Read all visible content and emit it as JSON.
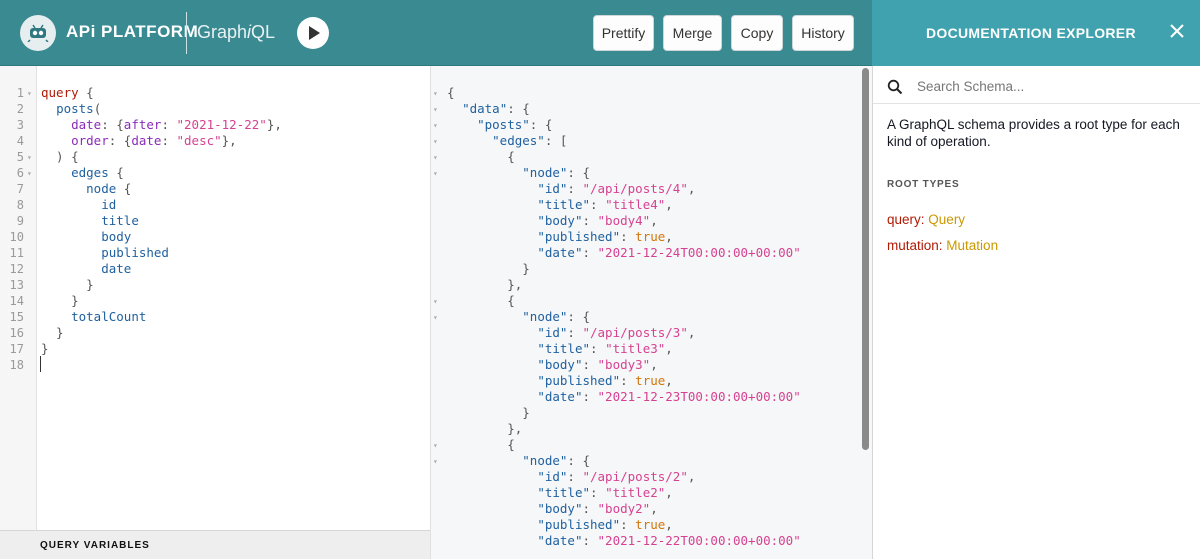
{
  "header": {
    "brand": "APi PLATFORM",
    "product_prefix": "Graph",
    "product_italic": "i",
    "product_suffix": "QL",
    "buttons": {
      "prettify": "Prettify",
      "merge": "Merge",
      "copy": "Copy",
      "history": "History"
    }
  },
  "docs": {
    "title": "DOCUMENTATION EXPLORER",
    "search_placeholder": "Search Schema...",
    "description": "A GraphQL schema provides a root type for each kind of operation.",
    "root_types_label": "ROOT TYPES",
    "root_types": [
      {
        "field": "query",
        "type": "Query"
      },
      {
        "field": "mutation",
        "type": "Mutation"
      }
    ]
  },
  "query_variables_label": "QUERY VARIABLES",
  "query_editor": {
    "lines": [
      [
        [
          "kw",
          "query"
        ],
        [
          "pun",
          " {"
        ]
      ],
      [
        [
          "pun",
          "  "
        ],
        [
          "fld",
          "posts"
        ],
        [
          "pun",
          "("
        ]
      ],
      [
        [
          "pun",
          "    "
        ],
        [
          "arg",
          "date"
        ],
        [
          "pun",
          ": {"
        ],
        [
          "arg",
          "after"
        ],
        [
          "pun",
          ": "
        ],
        [
          "str",
          "\"2021-12-22\""
        ],
        [
          "pun",
          "},"
        ]
      ],
      [
        [
          "pun",
          "    "
        ],
        [
          "arg",
          "order"
        ],
        [
          "pun",
          ": {"
        ],
        [
          "arg",
          "date"
        ],
        [
          "pun",
          ": "
        ],
        [
          "str",
          "\"desc\""
        ],
        [
          "pun",
          "},"
        ]
      ],
      [
        [
          "pun",
          "  ) {"
        ]
      ],
      [
        [
          "pun",
          "    "
        ],
        [
          "fld",
          "edges"
        ],
        [
          "pun",
          " {"
        ]
      ],
      [
        [
          "pun",
          "      "
        ],
        [
          "fld",
          "node"
        ],
        [
          "pun",
          " {"
        ]
      ],
      [
        [
          "pun",
          "        "
        ],
        [
          "fld",
          "id"
        ]
      ],
      [
        [
          "pun",
          "        "
        ],
        [
          "fld",
          "title"
        ]
      ],
      [
        [
          "pun",
          "        "
        ],
        [
          "fld",
          "body"
        ]
      ],
      [
        [
          "pun",
          "        "
        ],
        [
          "fld",
          "published"
        ]
      ],
      [
        [
          "pun",
          "        "
        ],
        [
          "fld",
          "date"
        ]
      ],
      [
        [
          "pun",
          "      }"
        ]
      ],
      [
        [
          "pun",
          "    }"
        ]
      ],
      [
        [
          "pun",
          "    "
        ],
        [
          "fld",
          "totalCount"
        ]
      ],
      [
        [
          "pun",
          "  }"
        ]
      ],
      [
        [
          "pun",
          "}"
        ]
      ],
      [
        [
          "pun",
          ""
        ]
      ]
    ],
    "line_numbers": [
      "1",
      "2",
      "3",
      "4",
      "5",
      "6",
      "7",
      "8",
      "9",
      "10",
      "11",
      "12",
      "13",
      "14",
      "15",
      "16",
      "17",
      "18"
    ],
    "fold_lines": [
      1,
      5,
      6
    ]
  },
  "result_viewer": {
    "lines": [
      [
        [
          "pun",
          "{"
        ]
      ],
      [
        [
          "pun",
          "  "
        ],
        [
          "rkey",
          "\"data\""
        ],
        [
          "pun",
          ": {"
        ]
      ],
      [
        [
          "pun",
          "    "
        ],
        [
          "rkey",
          "\"posts\""
        ],
        [
          "pun",
          ": {"
        ]
      ],
      [
        [
          "pun",
          "      "
        ],
        [
          "rkey",
          "\"edges\""
        ],
        [
          "pun",
          ": ["
        ]
      ],
      [
        [
          "pun",
          "        {"
        ]
      ],
      [
        [
          "pun",
          "          "
        ],
        [
          "rkey",
          "\"node\""
        ],
        [
          "pun",
          ": {"
        ]
      ],
      [
        [
          "pun",
          "            "
        ],
        [
          "rkey",
          "\"id\""
        ],
        [
          "pun",
          ": "
        ],
        [
          "str",
          "\"/api/posts/4\""
        ],
        [
          "pun",
          ","
        ]
      ],
      [
        [
          "pun",
          "            "
        ],
        [
          "rkey",
          "\"title\""
        ],
        [
          "pun",
          ": "
        ],
        [
          "str",
          "\"title4\""
        ],
        [
          "pun",
          ","
        ]
      ],
      [
        [
          "pun",
          "            "
        ],
        [
          "rkey",
          "\"body\""
        ],
        [
          "pun",
          ": "
        ],
        [
          "str",
          "\"body4\""
        ],
        [
          "pun",
          ","
        ]
      ],
      [
        [
          "pun",
          "            "
        ],
        [
          "rkey",
          "\"published\""
        ],
        [
          "pun",
          ": "
        ],
        [
          "bool",
          "true"
        ],
        [
          "pun",
          ","
        ]
      ],
      [
        [
          "pun",
          "            "
        ],
        [
          "rkey",
          "\"date\""
        ],
        [
          "pun",
          ": "
        ],
        [
          "str",
          "\"2021-12-24T00:00:00+00:00\""
        ]
      ],
      [
        [
          "pun",
          "          }"
        ]
      ],
      [
        [
          "pun",
          "        },"
        ]
      ],
      [
        [
          "pun",
          "        {"
        ]
      ],
      [
        [
          "pun",
          "          "
        ],
        [
          "rkey",
          "\"node\""
        ],
        [
          "pun",
          ": {"
        ]
      ],
      [
        [
          "pun",
          "            "
        ],
        [
          "rkey",
          "\"id\""
        ],
        [
          "pun",
          ": "
        ],
        [
          "str",
          "\"/api/posts/3\""
        ],
        [
          "pun",
          ","
        ]
      ],
      [
        [
          "pun",
          "            "
        ],
        [
          "rkey",
          "\"title\""
        ],
        [
          "pun",
          ": "
        ],
        [
          "str",
          "\"title3\""
        ],
        [
          "pun",
          ","
        ]
      ],
      [
        [
          "pun",
          "            "
        ],
        [
          "rkey",
          "\"body\""
        ],
        [
          "pun",
          ": "
        ],
        [
          "str",
          "\"body3\""
        ],
        [
          "pun",
          ","
        ]
      ],
      [
        [
          "pun",
          "            "
        ],
        [
          "rkey",
          "\"published\""
        ],
        [
          "pun",
          ": "
        ],
        [
          "bool",
          "true"
        ],
        [
          "pun",
          ","
        ]
      ],
      [
        [
          "pun",
          "            "
        ],
        [
          "rkey",
          "\"date\""
        ],
        [
          "pun",
          ": "
        ],
        [
          "str",
          "\"2021-12-23T00:00:00+00:00\""
        ]
      ],
      [
        [
          "pun",
          "          }"
        ]
      ],
      [
        [
          "pun",
          "        },"
        ]
      ],
      [
        [
          "pun",
          "        {"
        ]
      ],
      [
        [
          "pun",
          "          "
        ],
        [
          "rkey",
          "\"node\""
        ],
        [
          "pun",
          ": {"
        ]
      ],
      [
        [
          "pun",
          "            "
        ],
        [
          "rkey",
          "\"id\""
        ],
        [
          "pun",
          ": "
        ],
        [
          "str",
          "\"/api/posts/2\""
        ],
        [
          "pun",
          ","
        ]
      ],
      [
        [
          "pun",
          "            "
        ],
        [
          "rkey",
          "\"title\""
        ],
        [
          "pun",
          ": "
        ],
        [
          "str",
          "\"title2\""
        ],
        [
          "pun",
          ","
        ]
      ],
      [
        [
          "pun",
          "            "
        ],
        [
          "rkey",
          "\"body\""
        ],
        [
          "pun",
          ": "
        ],
        [
          "str",
          "\"body2\""
        ],
        [
          "pun",
          ","
        ]
      ],
      [
        [
          "pun",
          "            "
        ],
        [
          "rkey",
          "\"published\""
        ],
        [
          "pun",
          ": "
        ],
        [
          "bool",
          "true"
        ],
        [
          "pun",
          ","
        ]
      ],
      [
        [
          "pun",
          "            "
        ],
        [
          "rkey",
          "\"date\""
        ],
        [
          "pun",
          ": "
        ],
        [
          "str",
          "\"2021-12-22T00:00:00+00:00\""
        ]
      ],
      [
        [
          "pun",
          "          }"
        ]
      ]
    ],
    "fold_lines": [
      0,
      1,
      2,
      3,
      4,
      5,
      13,
      14,
      22,
      23
    ]
  },
  "colors": {
    "header": "#3a8a92",
    "doc_header": "#3fa2ae",
    "keyword": "#b11a04",
    "field": "#1f61a0",
    "argument": "#8b2bb9",
    "string": "#d64292",
    "boolean": "#d47509",
    "type": "#ca9800"
  },
  "icons": [
    "api-platform-logo-icon",
    "run-icon",
    "close-icon",
    "search-icon",
    "fold-arrow-icon"
  ]
}
